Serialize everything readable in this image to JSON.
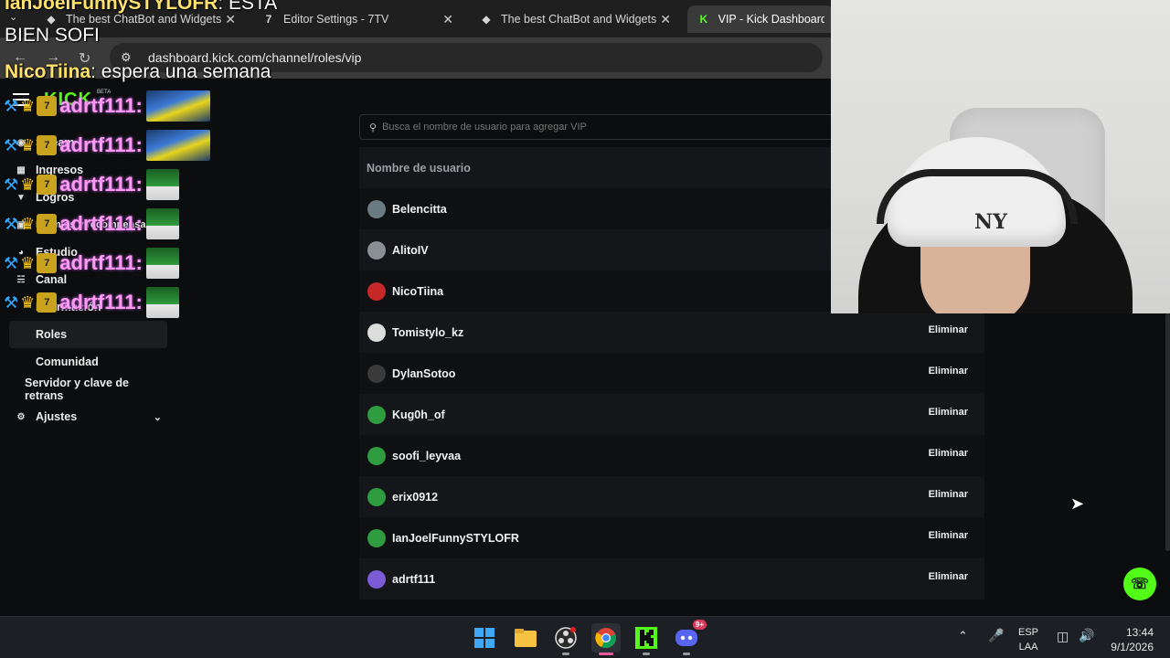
{
  "browser": {
    "tabs": [
      {
        "title": "The best ChatBot and Widgets f",
        "icon": "streamelements-icon"
      },
      {
        "title": "Editor Settings - 7TV",
        "icon": "seventv-icon"
      },
      {
        "title": "The best ChatBot and Widgets f",
        "icon": "streamelements-icon"
      },
      {
        "title": "VIP - Kick Dashboard",
        "icon": "kick-icon"
      }
    ],
    "url": "dashboard.kick.com/channel/roles/vip"
  },
  "chat_overlay": {
    "top_line_user": "IanJoelFunnySTYLOFR",
    "top_line_text": ": ESTA",
    "line2": "BIEN SOFI",
    "line3_user": "NicoTiina",
    "line3_text": ": espera una semana",
    "spam_user": "adrtf111:",
    "seven_badge": "7"
  },
  "sidebar": {
    "logo": "KICK",
    "logo_badge": "BETA",
    "items": [
      {
        "label": "Stream",
        "icon": "broadcast-icon"
      },
      {
        "label": "Ingresos",
        "icon": "income-icon"
      },
      {
        "label": "Logros",
        "icon": "trophy-icon"
      },
      {
        "label": "Premios y recompensas",
        "icon": "gift-icon"
      },
      {
        "label": "Estudio",
        "icon": "studio-icon"
      },
      {
        "label": "Canal",
        "icon": "channel-icon"
      },
      {
        "label": "Información"
      },
      {
        "label": "Roles"
      },
      {
        "label": "Comunidad"
      },
      {
        "label": "Servidor y clave de retrans"
      },
      {
        "label": "Ajustes",
        "icon": "gear-icon"
      }
    ]
  },
  "vip": {
    "search_placeholder": "Busca el nombre de usuario para agregar VIP",
    "column_header": "Nombre de usuario",
    "remove_label": "Eliminar",
    "users": [
      "Belencitta",
      "AlitoIV",
      "NicoTiina",
      "Tomistylo_kz",
      "DylanSotoo",
      "Kug0h_of",
      "soofi_leyvaa",
      "erix0912",
      "IanJoelFunnySTYLOFR",
      "adrtf111"
    ]
  },
  "taskbar": {
    "apps": [
      "windows-start-icon",
      "file-explorer-icon",
      "obs-icon",
      "chrome-icon",
      "kick-icon",
      "discord-icon"
    ],
    "discord_badge": "9+",
    "lang_line1": "ESP",
    "lang_line2": "LAA",
    "time": "13:44",
    "date": "9/1/2026"
  },
  "colors": {
    "kick_green": "#53fc18",
    "background": "#0b0d0e",
    "row_alt": "#141619"
  }
}
